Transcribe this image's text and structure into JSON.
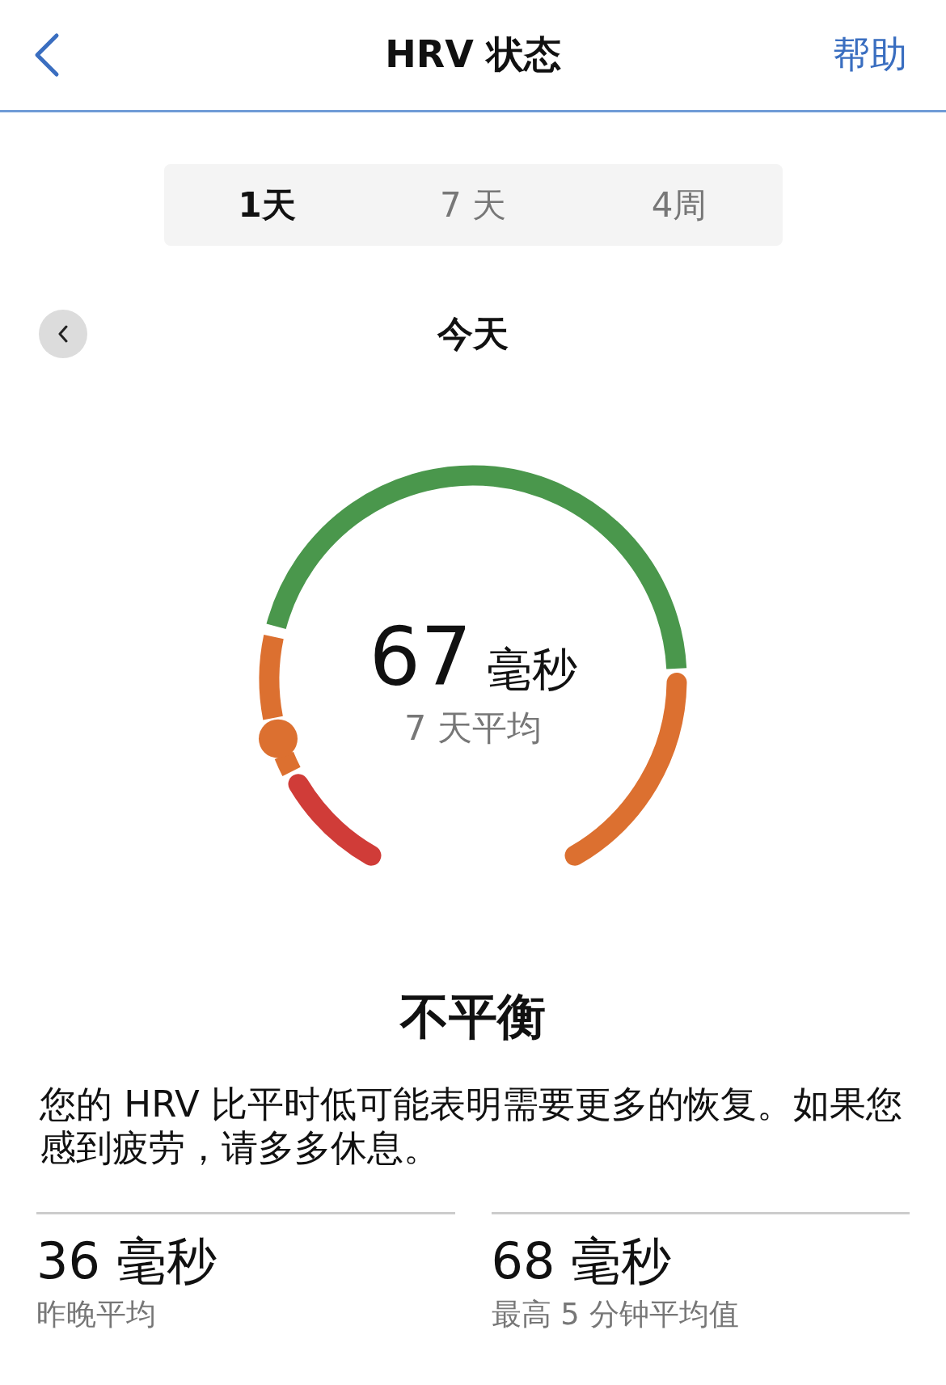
{
  "header": {
    "title": "HRV 状态",
    "help": "帮助"
  },
  "tabs": [
    {
      "label": "1天",
      "selected": true
    },
    {
      "label": "7 天",
      "selected": false
    },
    {
      "label": "4周",
      "selected": false
    }
  ],
  "date": {
    "label": "今天"
  },
  "gauge": {
    "value": "67",
    "unit": "毫秒",
    "caption": "7 天平均"
  },
  "status": {
    "title": "不平衡",
    "message": "您的 HRV 比平时低可能表明需要更多的恢复。如果您感到疲劳，请多多休息。"
  },
  "stats": [
    {
      "value": "36 毫秒",
      "label": "昨晚平均"
    },
    {
      "value": "68 毫秒",
      "label": "最高 5 分钟平均值"
    }
  ]
}
